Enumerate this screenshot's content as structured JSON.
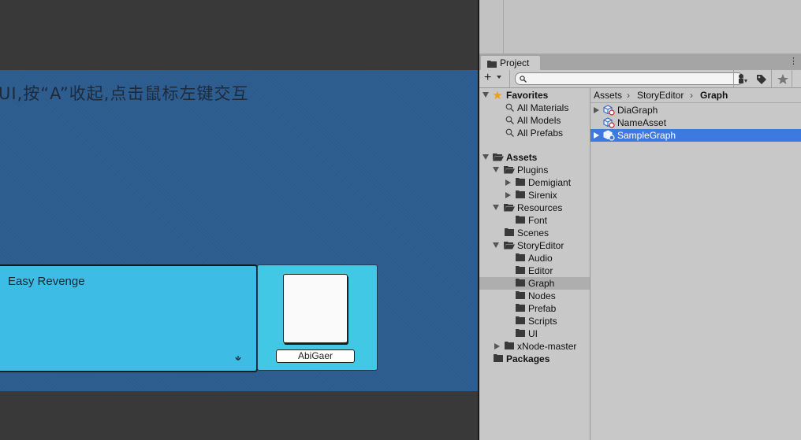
{
  "game": {
    "hint_text": "UI,按“A”收起,点击鼠标左键交互",
    "dialog_text": "Easy Revenge",
    "character_name": "AbiGaer"
  },
  "project": {
    "tab_label": "Project",
    "search_placeholder": "",
    "favorites": {
      "label": "Favorites",
      "items": [
        "All Materials",
        "All Models",
        "All Prefabs"
      ]
    },
    "assets": {
      "label": "Assets",
      "plugins": {
        "label": "Plugins",
        "children": [
          "Demigiant",
          "Sirenix"
        ]
      },
      "resources": {
        "label": "Resources",
        "children": [
          "Font"
        ]
      },
      "scenes": "Scenes",
      "story_editor": {
        "label": "StoryEditor",
        "children": [
          "Audio",
          "Editor",
          "Graph",
          "Nodes",
          "Prefab",
          "Scripts",
          "UI"
        ]
      },
      "xnode": "xNode-master"
    },
    "packages": "Packages",
    "breadcrumb": [
      "Assets",
      "StoryEditor",
      "Graph"
    ],
    "files": [
      "DiaGraph",
      "NameAsset",
      "SampleGraph"
    ],
    "selected_file": "SampleGraph",
    "selected_folder": "Graph"
  },
  "colors": {
    "game_background": "#2c5b8e",
    "dialog_box": "#3dbde6",
    "selection_blue": "#3d7ae0",
    "favorite_star": "#e8a317"
  },
  "icons": {
    "tab": "folder-icon",
    "create": "plus-icon",
    "search": "search-icon",
    "filter_type": "type-filter-icon",
    "filter_label": "label-tag-icon",
    "favorite": "star-icon",
    "dialog_indicator": "continue-icon"
  }
}
